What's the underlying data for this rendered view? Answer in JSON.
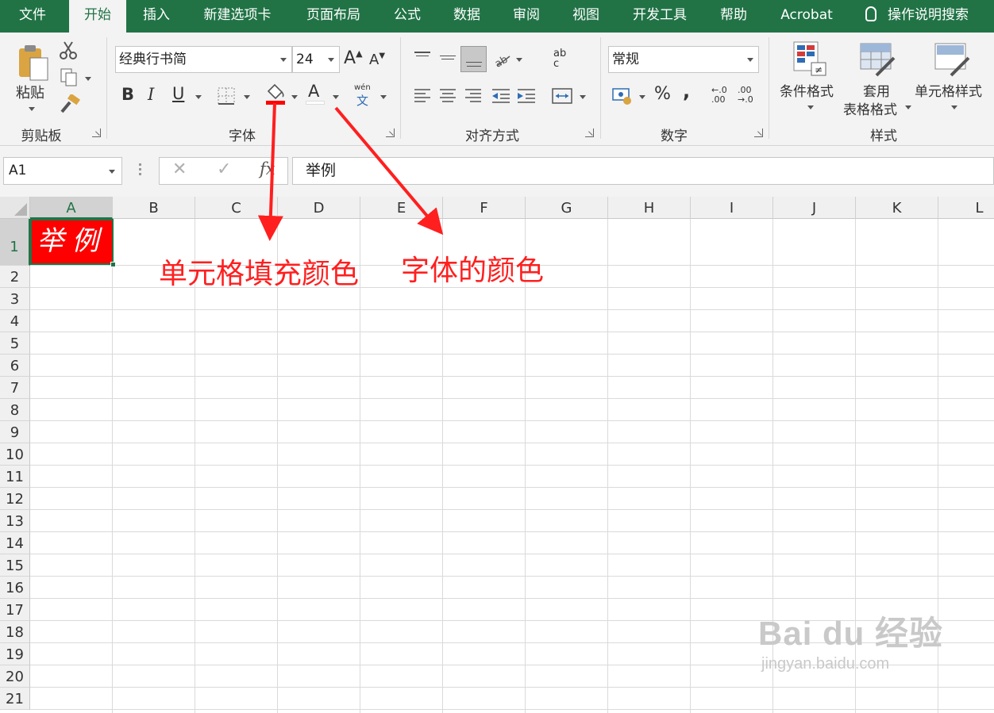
{
  "tabs": [
    {
      "label": "文件"
    },
    {
      "label": "开始"
    },
    {
      "label": "插入"
    },
    {
      "label": "新建选项卡"
    },
    {
      "label": "页面布局"
    },
    {
      "label": "公式"
    },
    {
      "label": "数据"
    },
    {
      "label": "审阅"
    },
    {
      "label": "视图"
    },
    {
      "label": "开发工具"
    },
    {
      "label": "帮助"
    },
    {
      "label": "Acrobat"
    }
  ],
  "tell_me": "操作说明搜索",
  "ribbon": {
    "clipboard": {
      "paste": "粘贴",
      "group": "剪贴板"
    },
    "font": {
      "name": "经典行书简",
      "size": "24",
      "grow": "A",
      "shrink": "A",
      "bold": "B",
      "italic": "I",
      "underline": "U",
      "font_color_glyph": "A",
      "phonetic_top": "wén",
      "phonetic_bottom": "文",
      "group": "字体",
      "fill_color": "#ff0000",
      "font_color": "#ffffff"
    },
    "alignment": {
      "wrap_glyph": "ab c",
      "group": "对齐方式"
    },
    "number": {
      "format": "常规",
      "percent": "%",
      "comma": ",",
      "inc_decimal": "←.0 .00",
      "dec_decimal": ".00 →.0",
      "group": "数字"
    },
    "styles": {
      "conditional": "条件格式",
      "table_fmt_1": "套用",
      "table_fmt_2": "表格格式",
      "cell_styles": "单元格样式",
      "group": "样式"
    }
  },
  "formula_bar": {
    "name_box": "A1",
    "fx": "fx",
    "content": "举例"
  },
  "sheet": {
    "columns": [
      "A",
      "B",
      "C",
      "D",
      "E",
      "F",
      "G",
      "H",
      "I",
      "J",
      "K",
      "L"
    ],
    "rows": [
      "1",
      "2",
      "3",
      "4",
      "5",
      "6",
      "7",
      "8",
      "9",
      "10",
      "11",
      "12",
      "13",
      "14",
      "15",
      "16",
      "17",
      "18",
      "19",
      "20",
      "21"
    ],
    "selected_cell": "A1",
    "a1_value": "举例",
    "a1_fill": "#ff0000"
  },
  "annotations": {
    "fill_label": "单元格填充颜色",
    "font_label": "字体的颜色",
    "color": "#ff1f1f"
  },
  "watermark": {
    "brand": "Bai du 经验",
    "url": "jingyan.baidu.com"
  }
}
